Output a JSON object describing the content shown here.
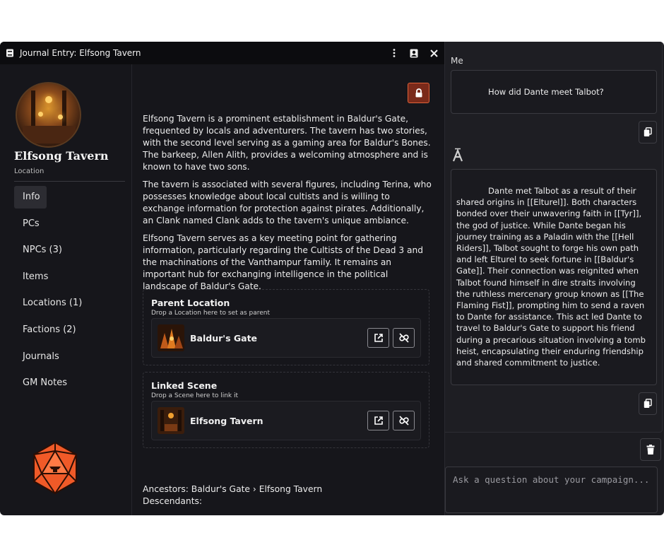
{
  "window": {
    "title": "Journal Entry: Elfsong Tavern"
  },
  "sidebar": {
    "name": "Elfsong Tavern",
    "type": "Location",
    "nav": [
      {
        "label": "Info",
        "active": true
      },
      {
        "label": "PCs"
      },
      {
        "label": "NPCs (3)"
      },
      {
        "label": "Items"
      },
      {
        "label": "Locations (1)"
      },
      {
        "label": "Factions (2)"
      },
      {
        "label": "Journals"
      },
      {
        "label": "GM Notes"
      }
    ]
  },
  "description": [
    "Elfsong Tavern is a prominent establishment in Baldur's Gate, frequented by locals and adventurers. The tavern has two stories, with the second level serving as a gaming area for Baldur's Bones. The barkeep, Allen Alith, provides a welcoming atmosphere and is known to have two sons.",
    "The tavern is associated with several figures, including Terina, who possesses knowledge about local cultists and is willing to exchange information for protection against pirates. Additionally, an Clank named Clank adds to the tavern's unique ambiance.",
    "Elfsong Tavern serves as a key meeting point for gathering information, particularly regarding the Cultists of the Dead 3 and the machinations of the Vanthampur family. It remains an important hub for exchanging intelligence in the political landscape of Baldur's Gate."
  ],
  "parent_location": {
    "title": "Parent Location",
    "hint": "Drop a Location here to set as parent",
    "item": "Baldur's Gate"
  },
  "linked_scene": {
    "title": "Linked Scene",
    "hint": "Drop a Scene here to link it",
    "item": "Elfsong Tavern"
  },
  "ancestry": {
    "ancestors": "Ancestors: Baldur's Gate › Elfsong Tavern",
    "descendants": "Descendants:"
  },
  "chat": {
    "me_label": "Me",
    "question": "How did Dante meet Talbot?",
    "answer": "Dante met Talbot as a result of their shared origins in [[Elturel]]. Both characters bonded over their unwavering faith in [[Tyr]], the god of justice. While Dante began his journey training as a Paladin with the [[Hell Riders]], Talbot sought to forge his own path and left Elturel to seek fortune in [[Baldur's Gate]]. Their connection was reignited when Talbot found himself in dire straits involving the ruthless mercenary group known as [[The Flaming Fist]], prompting him to send a raven to Dante for assistance. This act led Dante to travel to Baldur's Gate to support his friend during a precarious situation involving a tomb heist, encapsulating their enduring friendship and shared commitment to justice.",
    "input_placeholder": "Ask a question about your campaign..."
  },
  "colors": {
    "accent": "#e0623a",
    "lock_bg": "#7a2a1a",
    "d20": "#f05a28"
  },
  "icons": [
    "book-icon",
    "kebab-menu-icon",
    "portrait-icon",
    "close-icon",
    "lock-icon",
    "external-link-icon",
    "unlink-icon",
    "copy-icon",
    "ai-icon",
    "trash-icon",
    "d20-icon"
  ]
}
